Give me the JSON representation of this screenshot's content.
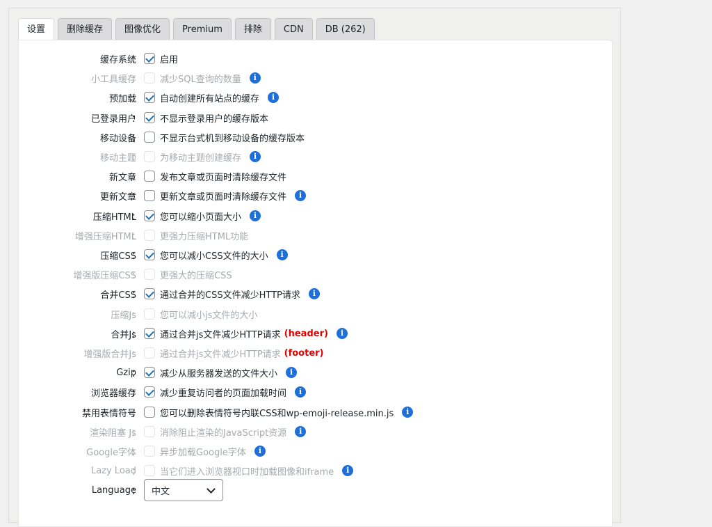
{
  "tabs": [
    {
      "label": "设置",
      "active": true
    },
    {
      "label": "删除缓存",
      "active": false
    },
    {
      "label": "图像优化",
      "active": false
    },
    {
      "label": "Premium",
      "active": false
    },
    {
      "label": "排除",
      "active": false
    },
    {
      "label": "CDN",
      "active": false
    },
    {
      "label": "DB (262)",
      "active": false
    }
  ],
  "settings": [
    {
      "label": "缓存系统",
      "desc": "启用",
      "checked": true,
      "disabled": false,
      "info": false
    },
    {
      "label": "小工具缓存",
      "desc": "减少SQL查询的数量",
      "checked": false,
      "disabled": true,
      "info": true
    },
    {
      "label": "预加载",
      "desc": "自动创建所有站点的缓存",
      "checked": true,
      "disabled": false,
      "info": true
    },
    {
      "label": "已登录用户",
      "desc": "不显示登录用户的缓存版本",
      "checked": true,
      "disabled": false,
      "info": false
    },
    {
      "label": "移动设备",
      "desc": "不显示台式机到移动设备的缓存版本",
      "checked": false,
      "disabled": false,
      "info": false
    },
    {
      "label": "移动主题",
      "desc": "为移动主题创建缓存",
      "checked": false,
      "disabled": true,
      "info": true
    },
    {
      "label": "新文章",
      "desc": "发布文章或页面时清除缓存文件",
      "checked": false,
      "disabled": false,
      "info": false
    },
    {
      "label": "更新文章",
      "desc": "更新文章或页面时清除缓存文件",
      "checked": false,
      "disabled": false,
      "info": true
    },
    {
      "label": "压缩HTML",
      "desc": "您可以缩小页面大小",
      "checked": true,
      "disabled": false,
      "info": true
    },
    {
      "label": "增强压缩HTML",
      "desc": "更强力压缩HTML功能",
      "checked": false,
      "disabled": true,
      "info": false
    },
    {
      "label": "压缩CSS",
      "desc": "您可以减小CSS文件的大小",
      "checked": true,
      "disabled": false,
      "info": true
    },
    {
      "label": "增强版压缩CSS",
      "desc": "更强大的压缩CSS",
      "checked": false,
      "disabled": true,
      "info": false
    },
    {
      "label": "合并CSS",
      "desc": "通过合并的CSS文件减少HTTP请求",
      "checked": true,
      "disabled": false,
      "info": true
    },
    {
      "label": "压缩Js",
      "desc": "您可以减小js文件的大小",
      "checked": false,
      "disabled": true,
      "info": false
    },
    {
      "label": "合并Js",
      "desc": "通过合并js文件减少HTTP请求",
      "tag": "(header)",
      "checked": true,
      "disabled": false,
      "info": true
    },
    {
      "label": "增强版合并Js",
      "desc": "通过合并js文件减少HTTP请求",
      "tag": "(footer)",
      "checked": false,
      "disabled": true,
      "info": false
    },
    {
      "label": "Gzip",
      "desc": "减少从服务器发送的文件大小",
      "checked": true,
      "disabled": false,
      "info": true
    },
    {
      "label": "浏览器缓存",
      "desc": "减少重复访问者的页面加载时间",
      "checked": true,
      "disabled": false,
      "info": true
    },
    {
      "label": "禁用表情符号",
      "desc": "您可以删除表情符号内联CSS和wp-emoji-release.min.js",
      "checked": false,
      "disabled": false,
      "info": true
    },
    {
      "label": "渲染阻塞 Js",
      "desc": "消除阻止渲染的JavaScript资源",
      "checked": false,
      "disabled": true,
      "info": true
    },
    {
      "label": "Google字体",
      "desc": "异步加载Google字体",
      "checked": false,
      "disabled": true,
      "info": true
    },
    {
      "label": "Lazy Load",
      "desc": "当它们进入浏览器视口时加载图像和iframe",
      "checked": false,
      "disabled": true,
      "info": true
    }
  ],
  "language": {
    "label": "Language",
    "value": "中文"
  },
  "colon": "：",
  "info_glyph": "i",
  "colors": {
    "accent": "#1e6fd9",
    "tag": "#e00000",
    "checkmark": "#2271b1"
  }
}
